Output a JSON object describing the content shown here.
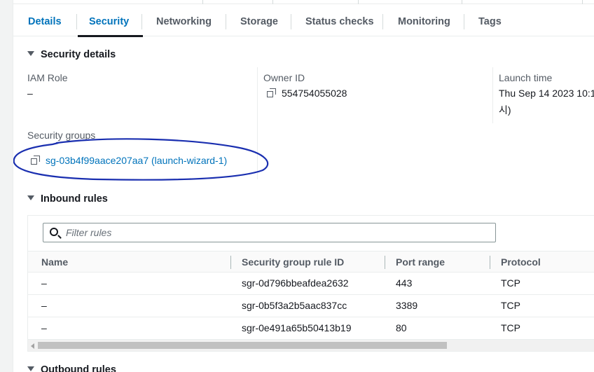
{
  "tabs": [
    {
      "label": "Details",
      "active": false
    },
    {
      "label": "Security",
      "active": true
    },
    {
      "label": "Networking",
      "active": false
    },
    {
      "label": "Storage",
      "active": false
    },
    {
      "label": "Status checks",
      "active": false
    },
    {
      "label": "Monitoring",
      "active": false
    },
    {
      "label": "Tags",
      "active": false
    }
  ],
  "security_details": {
    "heading": "Security details",
    "iam_role": {
      "label": "IAM Role",
      "value": "–"
    },
    "owner_id": {
      "label": "Owner ID",
      "value": "554754055028",
      "icon": "copy-icon"
    },
    "launch_time": {
      "label": "Launch time",
      "value_line1": "Thu Sep 14 2023 10:1",
      "value_line2": "시)"
    },
    "security_groups": {
      "label": "Security groups",
      "value": "sg-03b4f99aace207aa7 (launch-wizard-1)",
      "icon": "copy-icon"
    }
  },
  "annotation": {
    "color": "#1a2fb0",
    "shape": "hand-drawn ellipse around security group link"
  },
  "inbound": {
    "heading": "Inbound rules",
    "filter_placeholder": "Filter rules",
    "columns": [
      "Name",
      "Security group rule ID",
      "Port range",
      "Protocol"
    ],
    "rows": [
      {
        "name": "–",
        "rule_id": "sgr-0d796bbeafdea2632",
        "port": "443",
        "protocol": "TCP"
      },
      {
        "name": "–",
        "rule_id": "sgr-0b5f3a2b5aac837cc",
        "port": "3389",
        "protocol": "TCP"
      },
      {
        "name": "–",
        "rule_id": "sgr-0e491a65b50413b19",
        "port": "80",
        "protocol": "TCP"
      }
    ]
  },
  "outbound": {
    "heading": "Outbound rules"
  },
  "colors": {
    "link": "#0073bb",
    "tab_underline": "#16191f",
    "text": "#16191f",
    "muted": "#545b64"
  }
}
